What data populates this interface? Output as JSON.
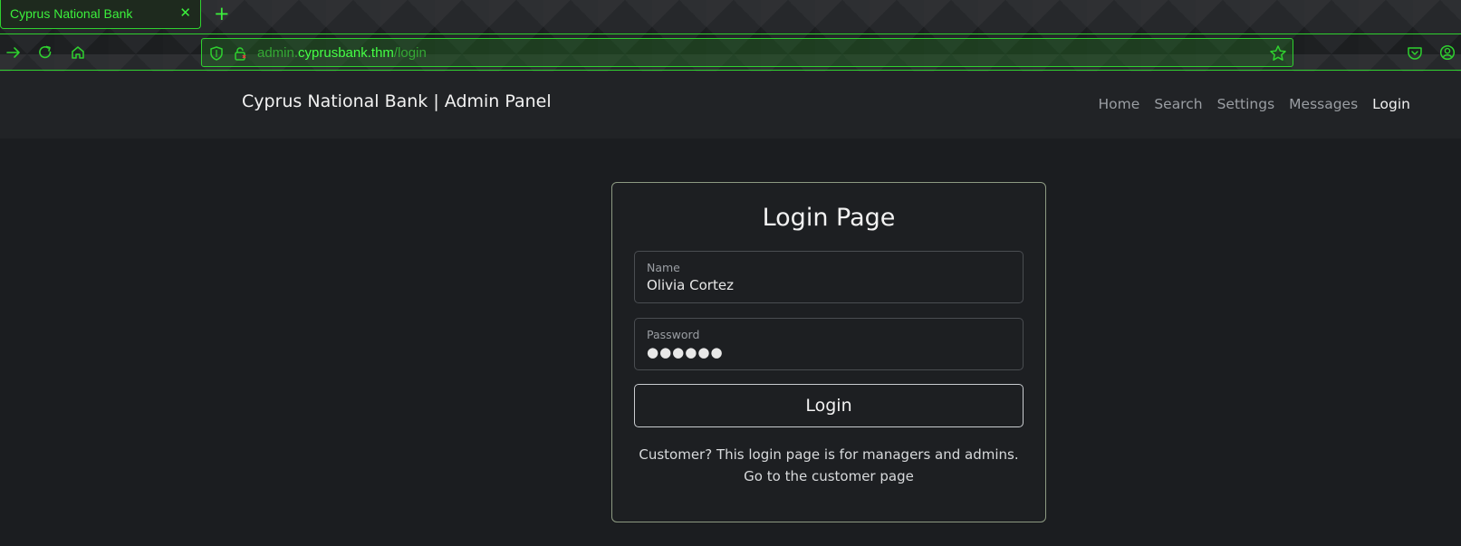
{
  "browser": {
    "tab_title": "Cyprus National Bank",
    "tab_close": "✕",
    "new_tab": "+",
    "url_prefix": "admin.",
    "url_domain": "cyprusbank.thm",
    "url_path": "/login",
    "accent_color": "#2fd12f",
    "icons": [
      "back-arrow-icon",
      "reload-icon",
      "home-icon",
      "shield-icon",
      "lock-icon",
      "bookmark-star-icon",
      "pocket-icon",
      "account-icon"
    ]
  },
  "navbar": {
    "brand": "Cyprus National Bank | Admin Panel",
    "links": [
      {
        "label": "Home",
        "active": false
      },
      {
        "label": "Search",
        "active": false
      },
      {
        "label": "Settings",
        "active": false
      },
      {
        "label": "Messages",
        "active": false
      },
      {
        "label": "Login",
        "active": true
      }
    ]
  },
  "login_card": {
    "title": "Login Page",
    "name_label": "Name",
    "name_value": "Olivia Cortez",
    "password_label": "Password",
    "password_value": "●●●●●●",
    "button_label": "Login",
    "note_line1": "Customer? This login page is for managers and admins.",
    "customer_link": "Go to the customer page"
  }
}
